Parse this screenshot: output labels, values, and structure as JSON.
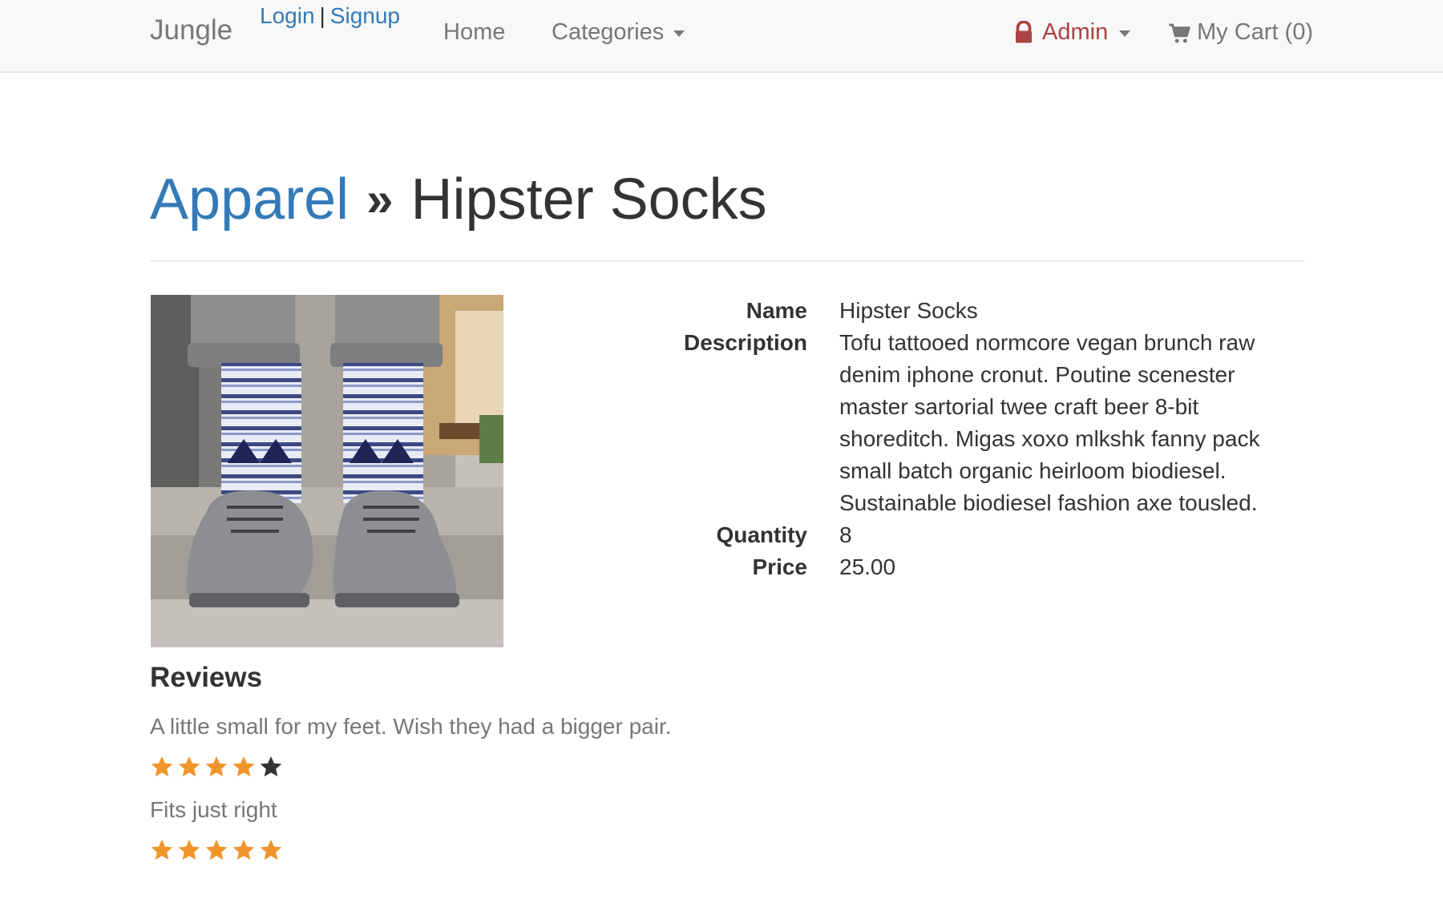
{
  "navbar": {
    "brand": "Jungle",
    "login": "Login",
    "separator": "|",
    "signup": "Signup",
    "home": "Home",
    "categories": "Categories",
    "admin": "Admin",
    "cart": "My Cart (0)"
  },
  "breadcrumb": {
    "category": "Apparel",
    "separator": "»",
    "product": "Hipster Socks"
  },
  "details": {
    "name_label": "Name",
    "name_value": "Hipster Socks",
    "description_label": "Description",
    "description_value": "Tofu tattooed normcore vegan brunch raw denim iphone cronut. Poutine scenester master sartorial twee craft beer 8-bit shoreditch. Migas xoxo mlkshk fanny pack small batch organic heirloom biodiesel. Sustainable biodiesel fashion axe tousled.",
    "quantity_label": "Quantity",
    "quantity_value": "8",
    "price_label": "Price",
    "price_value": "25.00"
  },
  "reviews": {
    "heading": "Reviews",
    "items": [
      {
        "text": "A little small for my feet. Wish they had a bigger pair.",
        "rating": 4,
        "max": 5
      },
      {
        "text": "Fits just right",
        "rating": 5,
        "max": 5
      }
    ]
  },
  "colors": {
    "link": "#337ab7",
    "admin": "#a94442",
    "star_filled": "#f0952b",
    "star_empty": "#333333"
  },
  "icons": [
    "lock-icon",
    "cart-icon",
    "caret-down-icon",
    "star-icon"
  ]
}
